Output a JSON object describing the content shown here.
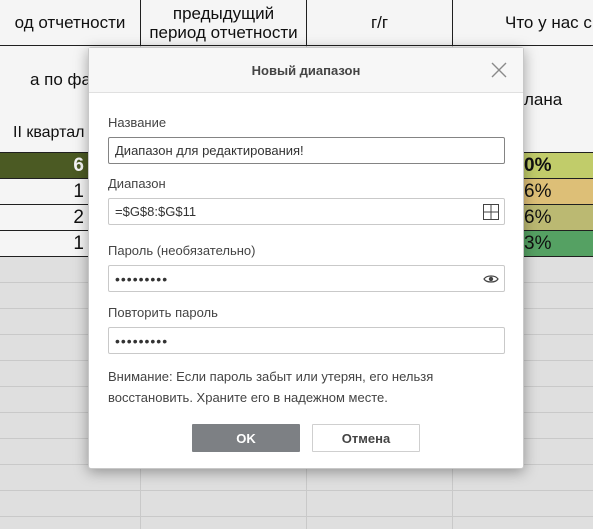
{
  "sheet": {
    "headers": {
      "col1": "од отчетности",
      "col2_line1": "предыдущий",
      "col2_line2": "период отчетности",
      "col3": "г/г",
      "col4": "Что у нас с"
    },
    "subheaders": {
      "col1_a": "а по фа",
      "col1_b": "II квартал",
      "col4": "лана"
    },
    "rows": [
      {
        "left": "6",
        "right": "0%"
      },
      {
        "left": "1",
        "right": "6%"
      },
      {
        "left": "2",
        "right": "6%"
      },
      {
        "left": "1",
        "right": "3%"
      }
    ],
    "colors": {
      "row1_left": "#4f5e25",
      "row1_right": "#c9d56f",
      "row2_right": "#e6c77c",
      "row3_right": "#c3c177",
      "row4_right": "#59a868"
    }
  },
  "dialog": {
    "title": "Новый диапазон",
    "name_label": "Название",
    "name_value": "Диапазон для редактирования!",
    "range_label": "Диапазон",
    "range_value": "=$G$8:$G$11",
    "password_label": "Пароль (необязательно)",
    "password_value": "•••••••••",
    "repeat_label": "Повторить пароль",
    "repeat_value": "•••••••••",
    "note": "Внимание: Если пароль забыт или утерян, его нельзя восстановить. Храните его в надежном месте.",
    "ok_label": "OK",
    "cancel_label": "Отмена"
  },
  "icons": {
    "close": "close-icon",
    "range_select": "grid-icon",
    "show_password": "eye-icon"
  }
}
